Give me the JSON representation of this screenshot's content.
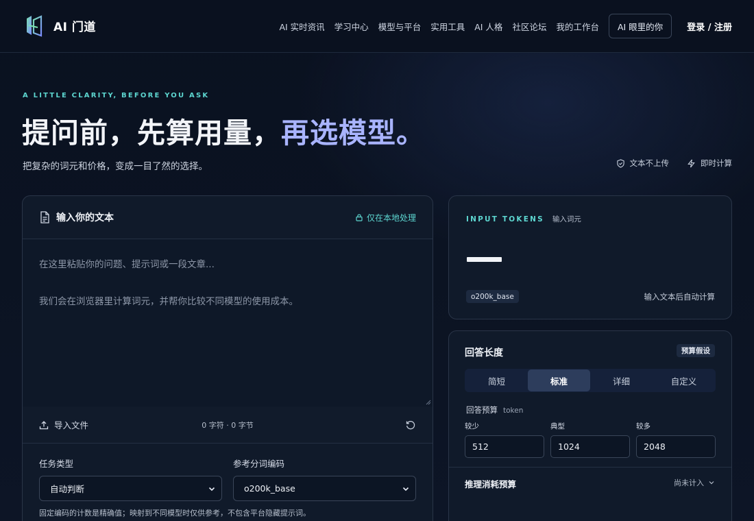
{
  "header": {
    "logo_text": "AI 门道",
    "nav": [
      "AI 实时资讯",
      "学习中心",
      "模型与平台",
      "实用工具",
      "AI 人格",
      "社区论坛",
      "我的工作台"
    ],
    "nav_box": "AI 眼里的你",
    "login": "登录 / 注册"
  },
  "hero": {
    "eyebrow": "A LITTLE CLARITY, BEFORE YOU ASK",
    "title_main": "提问前，先算用量，",
    "title_accent": "再选模型。",
    "subtitle": "把复杂的词元和价格，变成一目了然的选择。",
    "badge_upload": "文本不上传",
    "badge_instant": "即时计算"
  },
  "input_panel": {
    "title": "输入你的文本",
    "local_label": "仅在本地处理",
    "placeholder_line1": "在这里粘贴你的问题、提示词或一段文章...",
    "placeholder_line2": "我们会在浏览器里计算词元，并帮你比较不同模型的使用成本。",
    "import_label": "导入文件",
    "counts": "0 字符 · 0 字节",
    "task_label": "任务类型",
    "task_value": "自动判断",
    "encoding_label": "参考分词编码",
    "encoding_value": "o200k_base",
    "hint": "固定编码的计数是精确值；映射到不同模型时仅供参考，不包含平台隐藏提示词。"
  },
  "tokens_panel": {
    "label": "INPUT TOKENS",
    "sublabel": "输入词元",
    "encoding_chip": "o200k_base",
    "auto_text": "输入文本后自动计算"
  },
  "answer_panel": {
    "title": "回答长度",
    "tag": "预算假设",
    "tabs": [
      "简短",
      "标准",
      "详细",
      "自定义"
    ],
    "active_tab": "标准",
    "budget_label": "回答预算",
    "budget_unit": "token",
    "low_label": "较少",
    "low_value": "512",
    "typical_label": "典型",
    "typical_value": "1024",
    "high_label": "较多",
    "high_value": "2048",
    "reasoning_label": "推理消耗预算",
    "reasoning_value": "尚未计入"
  }
}
